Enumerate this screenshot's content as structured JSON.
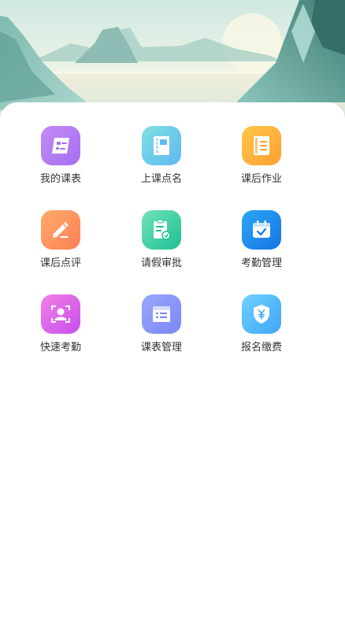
{
  "menu": {
    "items": [
      {
        "label": "我的课表",
        "icon": "schedule-icon",
        "color_from": "#c38bf7",
        "color_to": "#a46ff0"
      },
      {
        "label": "上课点名",
        "icon": "roll-call-book-icon",
        "color_from": "#7fe0e3",
        "color_to": "#5fb8f0"
      },
      {
        "label": "课后作业",
        "icon": "homework-notebook-icon",
        "color_from": "#ffc74c",
        "color_to": "#ff9f2f"
      },
      {
        "label": "课后点评",
        "icon": "pencil-review-icon",
        "color_from": "#ffab6b",
        "color_to": "#ff7f55"
      },
      {
        "label": "请假审批",
        "icon": "leave-approval-clipboard-icon",
        "color_from": "#6fe3b7",
        "color_to": "#1fbf94"
      },
      {
        "label": "考勤管理",
        "icon": "attendance-calendar-icon",
        "color_from": "#2ba6f3",
        "color_to": "#1675e8"
      },
      {
        "label": "快速考勤",
        "icon": "face-scan-icon",
        "color_from": "#f37ee6",
        "color_to": "#c64fec"
      },
      {
        "label": "课表管理",
        "icon": "timetable-manage-icon",
        "color_from": "#9aa7ff",
        "color_to": "#7b86f2"
      },
      {
        "label": "报名缴费",
        "icon": "yuan-shield-payment-icon",
        "color_from": "#6fd0ff",
        "color_to": "#3fa6f5"
      }
    ]
  }
}
